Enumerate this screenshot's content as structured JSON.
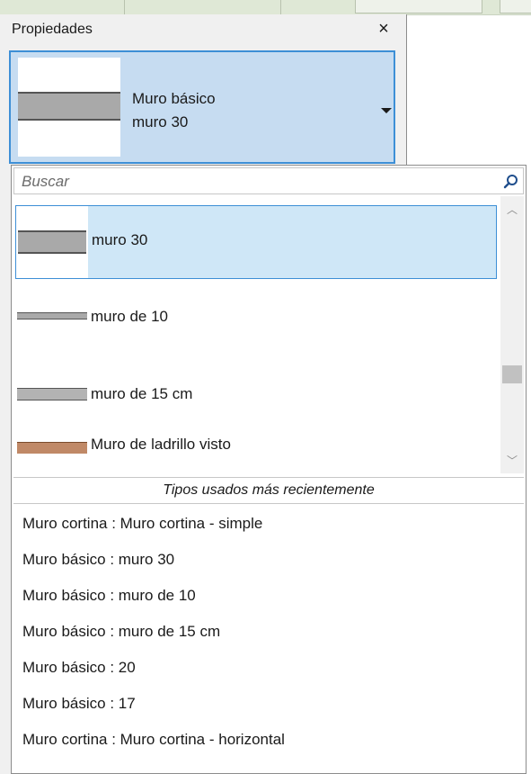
{
  "panel": {
    "title": "Propiedades",
    "close_symbol": "×"
  },
  "type_selector": {
    "family": "Muro básico",
    "type": "muro 30"
  },
  "search": {
    "placeholder": "Buscar",
    "icon": "search-icon"
  },
  "type_list": [
    {
      "label": "muro 30",
      "selected": true,
      "thumb": "thick-wall"
    },
    {
      "label": "muro de 10",
      "selected": false,
      "thumb": "thin-wall"
    },
    {
      "label": "muro de 15 cm",
      "selected": false,
      "thumb": "mid-wall"
    },
    {
      "label": "Muro de ladrillo visto",
      "selected": false,
      "thumb": "brick-wall"
    }
  ],
  "recent": {
    "header": "Tipos usados más recientemente",
    "items": [
      "Muro cortina : Muro cortina - simple",
      "Muro básico : muro 30",
      "Muro básico : muro de 10",
      "Muro básico : muro de 15 cm",
      "Muro básico : 20",
      "Muro básico : 17",
      "Muro cortina : Muro cortina - horizontal"
    ]
  },
  "colors": {
    "selection_fill": "#cfe7f7",
    "selection_border": "#3d8fd6",
    "brick": "#c08967"
  }
}
